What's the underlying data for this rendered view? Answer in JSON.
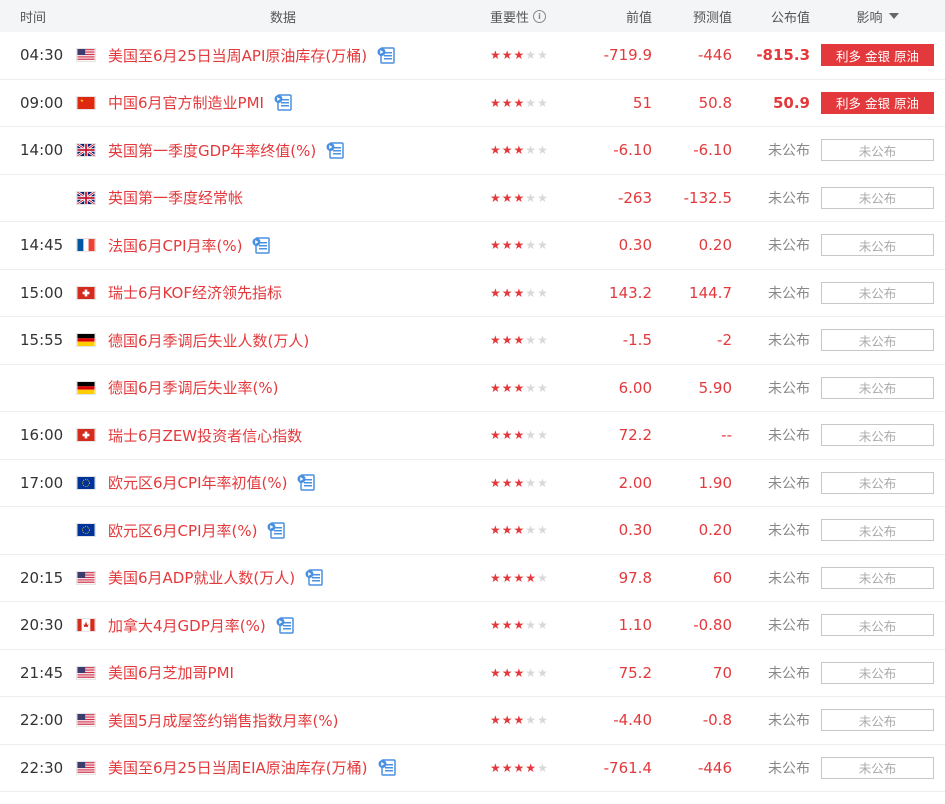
{
  "header": {
    "time": "时间",
    "data": "数据",
    "importance": "重要性",
    "previous": "前值",
    "forecast": "预测值",
    "actual": "公布值",
    "effect": "影响"
  },
  "colors": {
    "accent": "#e4393c",
    "pending_border": "#c8c8c8",
    "header_bg": "#f4f5f7"
  },
  "rows": [
    {
      "time": "04:30",
      "flag": "us",
      "event": "美国至6月25日当周API原油库存(万桶)",
      "doc": true,
      "stars": 3,
      "previous": "-719.9",
      "forecast": "-446",
      "actual": "-815.3",
      "actual_hi": true,
      "effect": "利多 金银 原油",
      "effect_type": "bull"
    },
    {
      "time": "09:00",
      "flag": "cn",
      "event": "中国6月官方制造业PMI",
      "doc": true,
      "stars": 3,
      "previous": "51",
      "forecast": "50.8",
      "actual": "50.9",
      "actual_hi": true,
      "effect": "利多 金银 原油",
      "effect_type": "bull"
    },
    {
      "time": "14:00",
      "flag": "uk",
      "event": "英国第一季度GDP年率终值(%)",
      "doc": true,
      "stars": 3,
      "previous": "-6.10",
      "forecast": "-6.10",
      "actual": "未公布",
      "actual_hi": false,
      "effect": "未公布",
      "effect_type": "pending"
    },
    {
      "time": "",
      "flag": "uk",
      "event": "英国第一季度经常帐",
      "doc": false,
      "stars": 3,
      "previous": "-263",
      "forecast": "-132.5",
      "actual": "未公布",
      "actual_hi": false,
      "effect": "未公布",
      "effect_type": "pending"
    },
    {
      "time": "14:45",
      "flag": "fr",
      "event": "法国6月CPI月率(%)",
      "doc": true,
      "stars": 3,
      "previous": "0.30",
      "forecast": "0.20",
      "actual": "未公布",
      "actual_hi": false,
      "effect": "未公布",
      "effect_type": "pending"
    },
    {
      "time": "15:00",
      "flag": "ch",
      "event": "瑞士6月KOF经济领先指标",
      "doc": false,
      "stars": 3,
      "previous": "143.2",
      "forecast": "144.7",
      "actual": "未公布",
      "actual_hi": false,
      "effect": "未公布",
      "effect_type": "pending"
    },
    {
      "time": "15:55",
      "flag": "de",
      "event": "德国6月季调后失业人数(万人)",
      "doc": false,
      "stars": 3,
      "previous": "-1.5",
      "forecast": "-2",
      "actual": "未公布",
      "actual_hi": false,
      "effect": "未公布",
      "effect_type": "pending"
    },
    {
      "time": "",
      "flag": "de",
      "event": "德国6月季调后失业率(%)",
      "doc": false,
      "stars": 3,
      "previous": "6.00",
      "forecast": "5.90",
      "actual": "未公布",
      "actual_hi": false,
      "effect": "未公布",
      "effect_type": "pending"
    },
    {
      "time": "16:00",
      "flag": "ch",
      "event": "瑞士6月ZEW投资者信心指数",
      "doc": false,
      "stars": 3,
      "previous": "72.2",
      "forecast": "--",
      "actual": "未公布",
      "actual_hi": false,
      "effect": "未公布",
      "effect_type": "pending"
    },
    {
      "time": "17:00",
      "flag": "eu",
      "event": "欧元区6月CPI年率初值(%)",
      "doc": true,
      "stars": 3,
      "previous": "2.00",
      "forecast": "1.90",
      "actual": "未公布",
      "actual_hi": false,
      "effect": "未公布",
      "effect_type": "pending"
    },
    {
      "time": "",
      "flag": "eu",
      "event": "欧元区6月CPI月率(%)",
      "doc": true,
      "stars": 3,
      "previous": "0.30",
      "forecast": "0.20",
      "actual": "未公布",
      "actual_hi": false,
      "effect": "未公布",
      "effect_type": "pending"
    },
    {
      "time": "20:15",
      "flag": "us",
      "event": "美国6月ADP就业人数(万人)",
      "doc": true,
      "stars": 4,
      "previous": "97.8",
      "forecast": "60",
      "actual": "未公布",
      "actual_hi": false,
      "effect": "未公布",
      "effect_type": "pending"
    },
    {
      "time": "20:30",
      "flag": "ca",
      "event": "加拿大4月GDP月率(%)",
      "doc": true,
      "stars": 3,
      "previous": "1.10",
      "forecast": "-0.80",
      "actual": "未公布",
      "actual_hi": false,
      "effect": "未公布",
      "effect_type": "pending"
    },
    {
      "time": "21:45",
      "flag": "us",
      "event": "美国6月芝加哥PMI",
      "doc": false,
      "stars": 3,
      "previous": "75.2",
      "forecast": "70",
      "actual": "未公布",
      "actual_hi": false,
      "effect": "未公布",
      "effect_type": "pending"
    },
    {
      "time": "22:00",
      "flag": "us",
      "event": "美国5月成屋签约销售指数月率(%)",
      "doc": false,
      "stars": 3,
      "previous": "-4.40",
      "forecast": "-0.8",
      "actual": "未公布",
      "actual_hi": false,
      "effect": "未公布",
      "effect_type": "pending"
    },
    {
      "time": "22:30",
      "flag": "us",
      "event": "美国至6月25日当周EIA原油库存(万桶)",
      "doc": true,
      "stars": 4,
      "previous": "-761.4",
      "forecast": "-446",
      "actual": "未公布",
      "actual_hi": false,
      "effect": "未公布",
      "effect_type": "pending"
    }
  ]
}
